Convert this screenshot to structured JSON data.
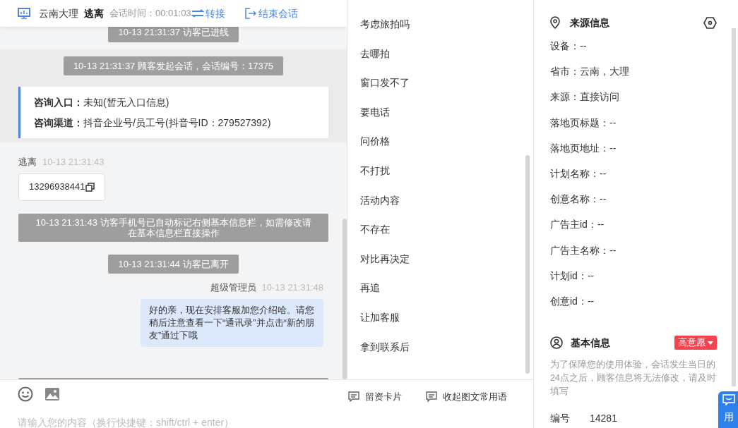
{
  "header": {
    "title": "云南大理",
    "visitor": "逃离",
    "session_time": "会话时间：00:01:03",
    "transfer": "转接",
    "end": "结束会话"
  },
  "messages": [
    {
      "kind": "system",
      "text": "10-13 21:31:37 访客已进线"
    },
    {
      "kind": "session",
      "text": "10-13 21:31:37 顾客发起会话，会话编号：17375",
      "fields": [
        {
          "label": "咨询入口：",
          "value": "未知(暂无入口信息)"
        },
        {
          "label": "咨询渠道：",
          "value": "抖音企业号/员工号(抖音号ID：279527392)"
        }
      ]
    },
    {
      "kind": "visitor",
      "name": "逃离",
      "time": "10-13 21:31:43",
      "text": "13296938441"
    },
    {
      "kind": "system_wide",
      "text": "10-13 21:31:43 访客手机号已自动标记右侧基本信息栏，如需修改请在基本信息栏直接操作"
    },
    {
      "kind": "system",
      "text": "10-13 21:31:44 访客已离开"
    },
    {
      "kind": "agent",
      "name": "超级管理员",
      "time": "10-13 21:31:48",
      "text": "好的亲，现在安排客服加您介绍哈。请您稍后注意查看一下“通讯录”并点击“新的朋友”通过下哦"
    },
    {
      "kind": "cut_bar"
    }
  ],
  "phrases": [
    "考虑旅拍吗",
    "去哪拍",
    "窗口发不了",
    "要电话",
    "问价格",
    "不打扰",
    "活动内容",
    "不存在",
    "对比再决定",
    "再追",
    "让加客服",
    "拿到联系后"
  ],
  "toolbar": {
    "card": "留资卡片",
    "collapse": "收起图文常用语",
    "placeholder": "请输入您的内容（换行快捷键：shift/ctrl + enter）"
  },
  "source_info": {
    "title": "来源信息",
    "rows": [
      "设备：--",
      "省市：云南，大理",
      "来源：直接访问",
      "落地页标题：--",
      "落地页地址：--",
      "计划名称：--",
      "创意名称：--",
      "广告主id：--",
      "广告主名称：--",
      "计划id：--",
      "创意id：--"
    ]
  },
  "basic_info": {
    "title": "基本信息",
    "intent": "高意愿",
    "notice": "为了保障您的使用体验，会话发生当日的24点之后，顾客信息将无法修改，请及时填写",
    "number_label": "编号",
    "number_value": "14281"
  },
  "float_button": {
    "label": "用"
  }
}
